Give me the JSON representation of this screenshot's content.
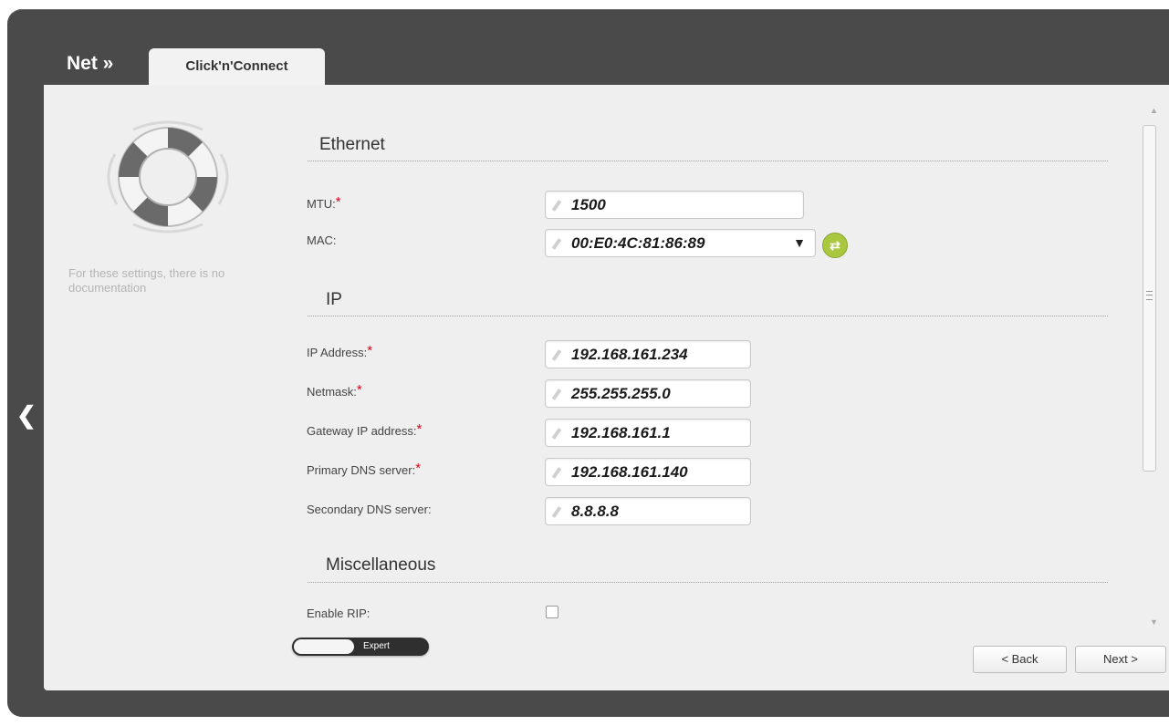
{
  "header": {
    "breadcrumb": "Net »",
    "tab_label": "Click'n'Connect"
  },
  "sidebar": {
    "note": "For these settings, there is no documentation",
    "back_arrow_icon": "chevron-left-icon",
    "logo_icon": "lifebuoy-icon"
  },
  "ethernet": {
    "title": "Ethernet",
    "mtu_label": "MTU:",
    "mtu_value": "1500",
    "mac_label": "MAC:",
    "mac_value": "00:E0:4C:81:86:89",
    "refresh_icon": "refresh-icon"
  },
  "ip": {
    "title": "IP",
    "fields": [
      {
        "label": "IP Address:",
        "required": true,
        "value": "192.168.161.234"
      },
      {
        "label": "Netmask:",
        "required": true,
        "value": "255.255.255.0"
      },
      {
        "label": "Gateway IP address:",
        "required": true,
        "value": "192.168.161.1"
      },
      {
        "label": "Primary DNS server:",
        "required": true,
        "value": "192.168.161.140"
      },
      {
        "label": "Secondary DNS server:",
        "required": false,
        "value": "8.8.8.8"
      }
    ]
  },
  "misc": {
    "title": "Miscellaneous",
    "rip_label": "Enable RIP:",
    "rip_checked": false
  },
  "footer": {
    "expert_label": "Expert",
    "back_label": "< Back",
    "next_label": "Next >"
  },
  "colors": {
    "frame": "#4a4a4a",
    "panel": "#efefef",
    "required": "#e0001b",
    "refresh": "#a9c83f"
  }
}
